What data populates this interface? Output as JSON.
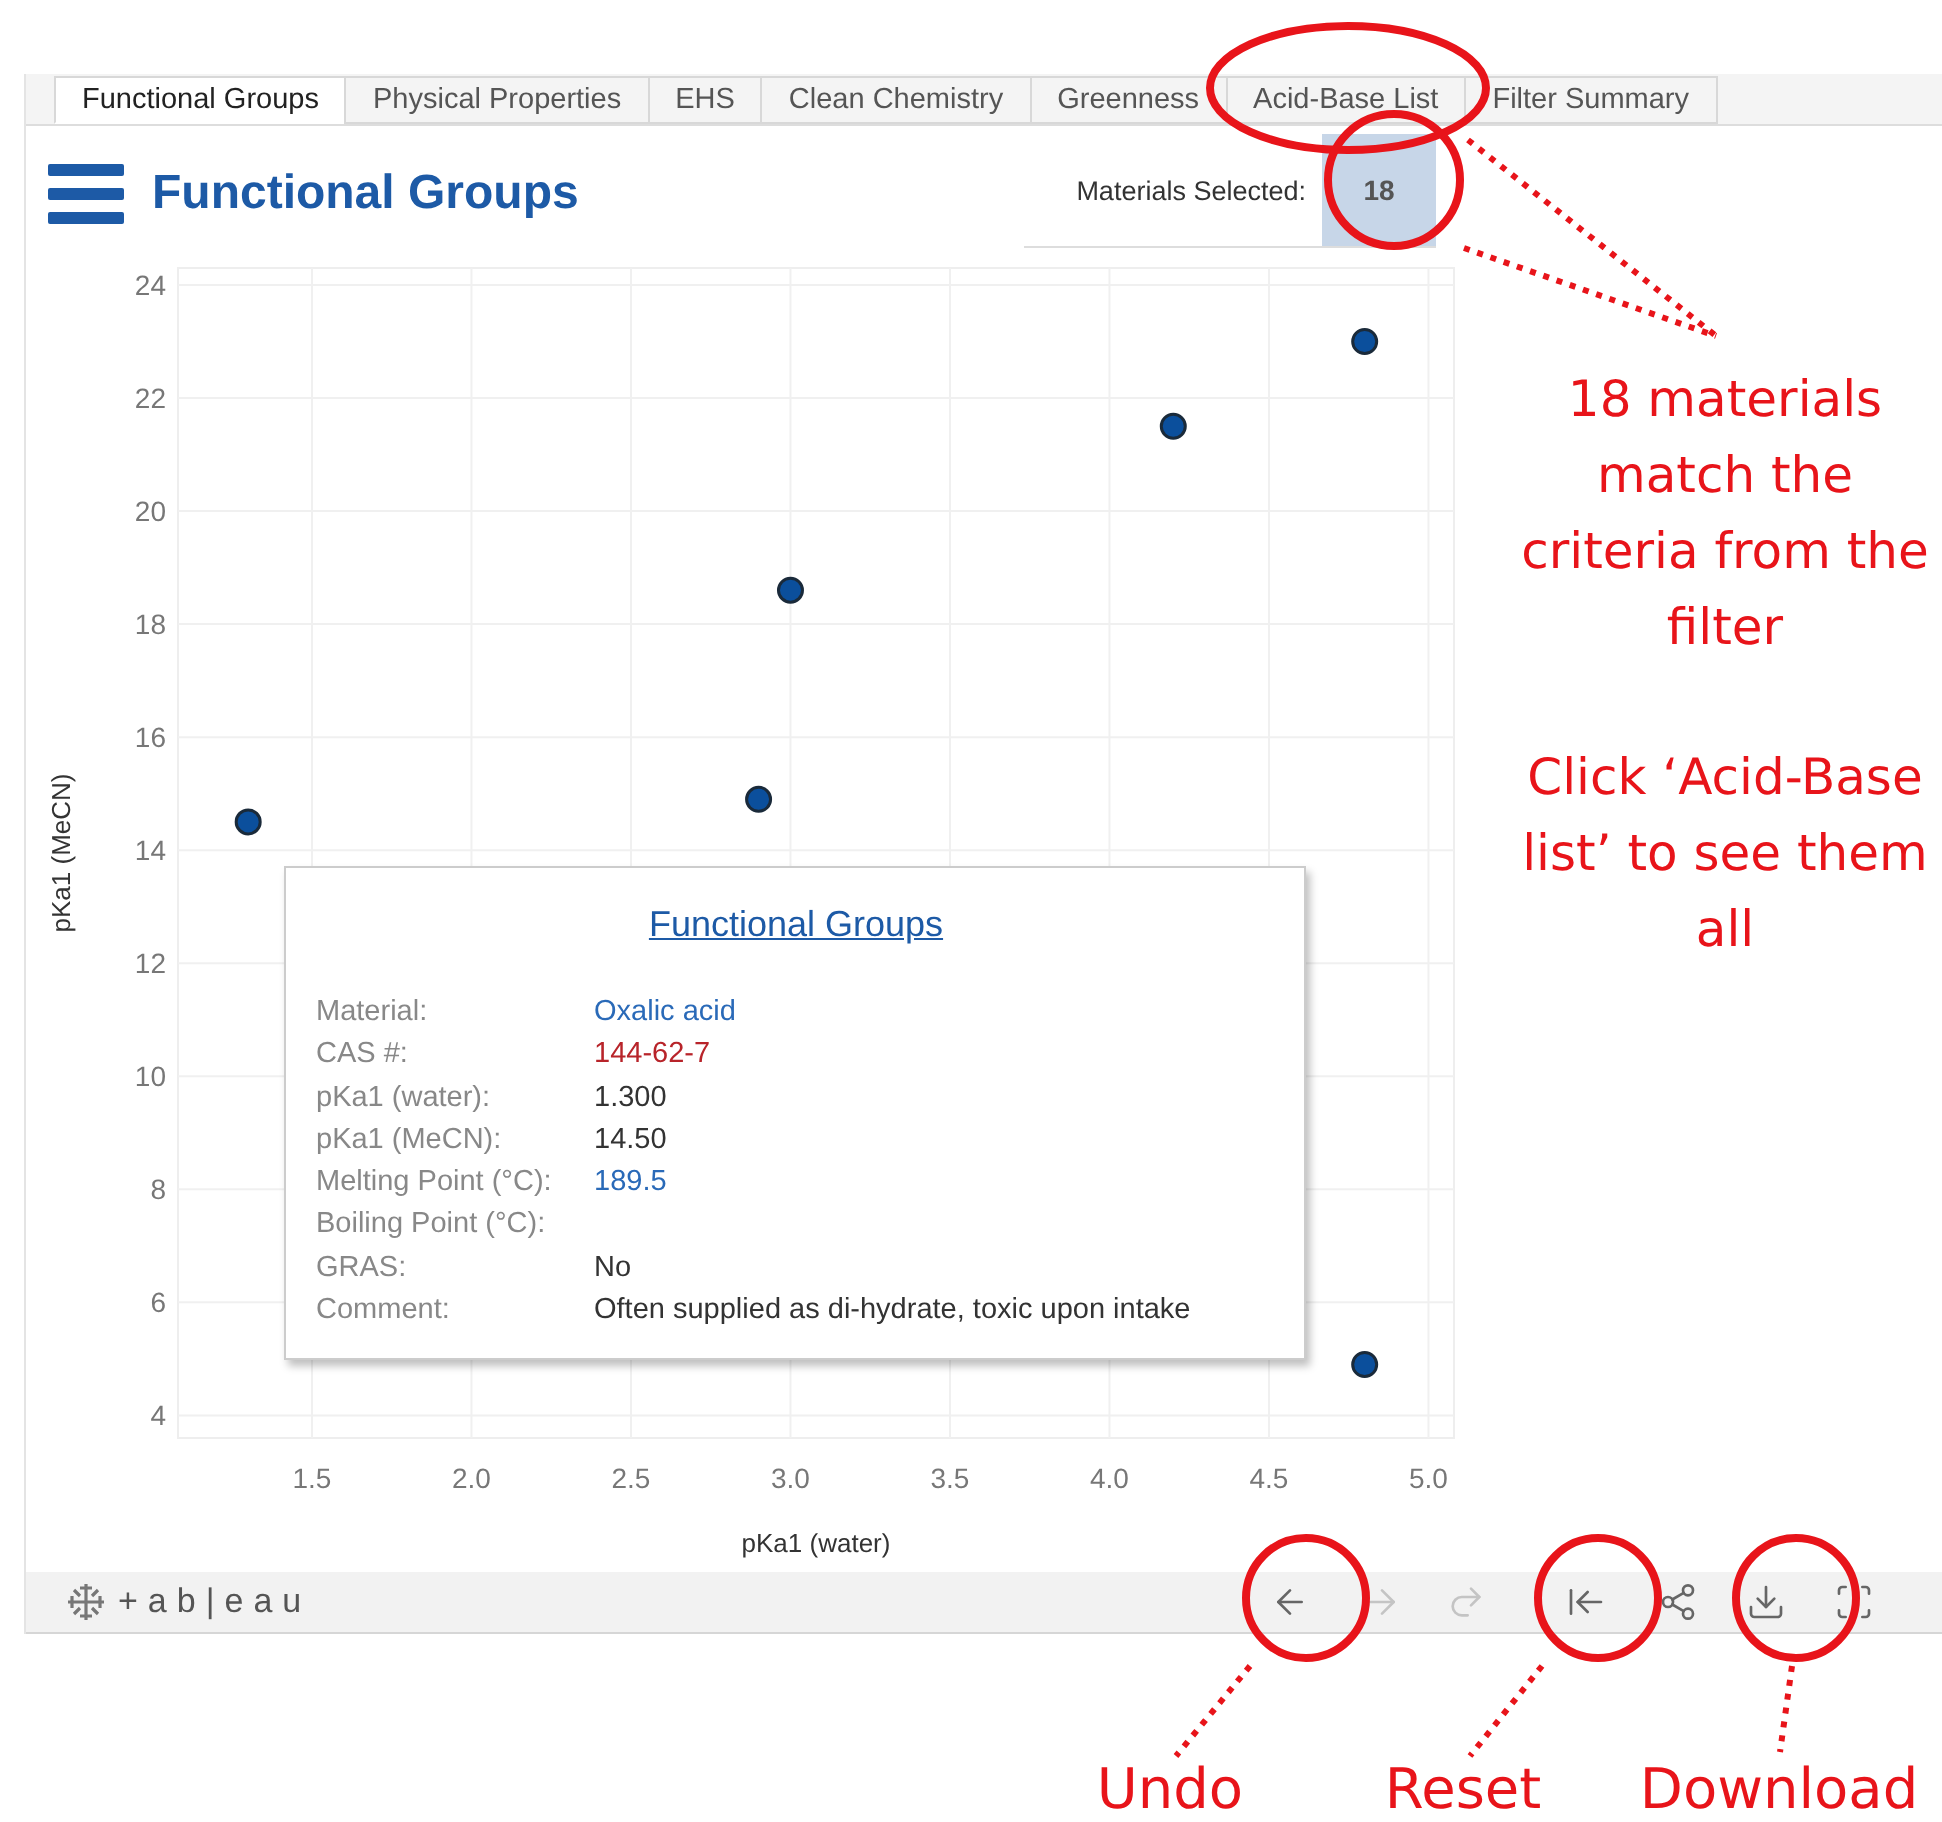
{
  "tabs": [
    {
      "label": "Functional Groups",
      "selected": true
    },
    {
      "label": "Physical Properties",
      "selected": false
    },
    {
      "label": "EHS",
      "selected": false
    },
    {
      "label": "Clean Chemistry",
      "selected": false
    },
    {
      "label": "Greenness",
      "selected": false
    },
    {
      "label": "Acid-Base List",
      "selected": false
    },
    {
      "label": "Filter Summary",
      "selected": false
    }
  ],
  "header": {
    "title": "Functional Groups",
    "selection_label": "Materials Selected:",
    "selection_count": "18"
  },
  "chart": {
    "chart_data": {
      "type": "scatter",
      "xlabel": "pKa1 (water)",
      "ylabel": "pKa1 (MeCN)",
      "x": [
        1.3,
        2.9,
        3.0,
        4.2,
        4.8,
        4.8
      ],
      "series": [
        {
          "color": "#0b4f9c",
          "values": [
            14.5,
            14.9,
            18.6,
            21.5,
            23.0,
            4.9
          ]
        }
      ],
      "grid": true,
      "xlim": [
        1.08,
        5.08
      ],
      "ylim": [
        3.6,
        24.3
      ],
      "xticks": [
        {
          "value": 1.5,
          "label": "1.5"
        },
        {
          "value": 2.0,
          "label": "2.0"
        },
        {
          "value": 2.5,
          "label": "2.5"
        },
        {
          "value": 3.0,
          "label": "3.0"
        },
        {
          "value": 3.5,
          "label": "3.5"
        },
        {
          "value": 4.0,
          "label": "4.0"
        },
        {
          "value": 4.5,
          "label": "4.5"
        },
        {
          "value": 5.0,
          "label": "5.0"
        }
      ],
      "yticks": [
        4,
        6,
        8,
        10,
        12,
        14,
        16,
        18,
        20,
        22,
        24
      ]
    }
  },
  "tooltip": {
    "title": "Functional Groups",
    "rows": [
      {
        "label": "Material:",
        "value": "Oxalic acid",
        "color": "#2a6ab8"
      },
      {
        "label": "CAS #:",
        "value": "144-62-7",
        "color": "#b8242a"
      },
      {
        "label": "pKa1 (water):",
        "value": "1.300",
        "color": "#333333"
      },
      {
        "label": "pKa1 (MeCN):",
        "value": "14.50",
        "color": "#333333"
      },
      {
        "label": "Melting Point (°C):",
        "value": "189.5",
        "color": "#2a6ab8"
      },
      {
        "label": "Boiling Point (°C):"
      },
      {
        "label": "GRAS:",
        "value": "No",
        "color": "#333333"
      },
      {
        "label": "Comment:",
        "value": "Often supplied as di-hydrate, toxic upon intake",
        "color": "#333333"
      }
    ]
  },
  "footer": {
    "logo": "+ab|eau",
    "buttons": [
      {
        "kind": "undo",
        "disabled": false
      },
      {
        "kind": "redo",
        "disabled": true
      },
      {
        "kind": "replay",
        "disabled": true
      },
      {
        "kind": "reset",
        "disabled": false
      },
      {
        "kind": "share",
        "disabled": false
      },
      {
        "kind": "download",
        "disabled": false
      },
      {
        "kind": "fullscreen",
        "disabled": false
      }
    ]
  },
  "annotations": [
    {
      "kind": "note",
      "text": "18 materials match the criteria from the filter"
    },
    {
      "kind": "note",
      "text": "Click ‘Acid-Base list’ to see them all"
    },
    {
      "kind": "label",
      "text": "Undo"
    },
    {
      "kind": "label",
      "text": "Reset"
    },
    {
      "kind": "label",
      "text": "Download"
    }
  ]
}
